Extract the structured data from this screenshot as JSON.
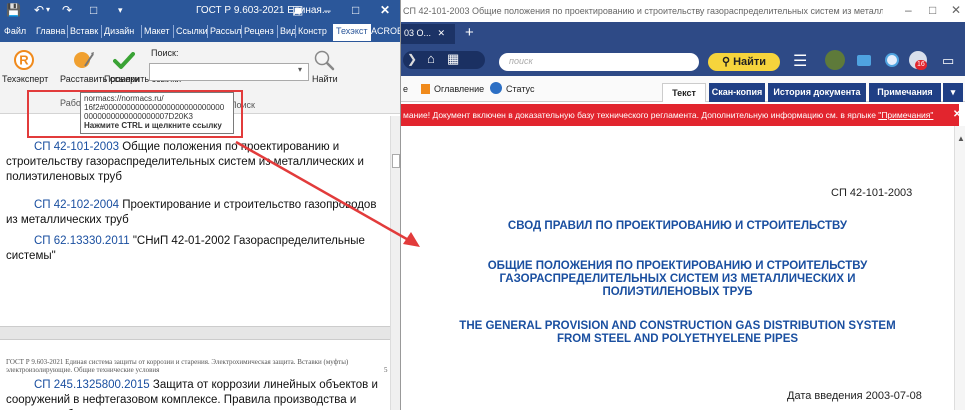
{
  "word": {
    "title": "ГОСТ Р 9.603-2021 Единая...",
    "tabs": [
      "Файл",
      "Главна",
      "Вставк",
      "Дизайн",
      "Макет",
      "Ссылки",
      "Рассыл",
      "Реценз",
      "Вид",
      "Констр",
      "Техэкст",
      "ACROB"
    ],
    "selected_tab": "Техэкст",
    "ribbon": {
      "btn_techexpert": "Техэксперт",
      "btn_arrange": "Расставить ссылки",
      "btn_check": "Проверить ссылки",
      "group_work": "Работ...",
      "search_label": "Поиск:",
      "search_value": "",
      "btn_find": "Найти",
      "group_search": "Поиск"
    },
    "tooltip": {
      "line1": "normacs://normacs.ru/",
      "line2": "16f2#000000000000000000000000000",
      "line3": "0000000000000000007D20K3",
      "hint": "Нажмите CTRL и щелкните ссылку"
    },
    "doc": [
      {
        "link": "СП 42-101-2003",
        "text": " Общие положения по проектированию и строительству газораспределительных систем из металлических и полиэтиленовых труб"
      },
      {
        "link": "СП 42-102-2004",
        "text": " Проектирование и строительство газопроводов из металлических труб"
      },
      {
        "link": "СП 62.13330.2011",
        "text": " \"СНиП 42-01-2002 Газораспределительные системы\""
      }
    ],
    "page_header": "ГОСТ Р 9.603-2021 Единая система защиты от коррозии и старения. Электрохимическая защита. Вставки (муфты) электроизолирующие. Общие технические условия",
    "page_number": "5",
    "doc2": {
      "link": "СП 245.1325800.2015",
      "text": " Защита от коррозии линейных объектов и сооружений в нефтегазовом комплексе. Правила производства и приемки работ"
    }
  },
  "browser": {
    "title": "СП 42-101-2003 Общие положения по проектированию и строительству газораспределительных систем из металлических и полиэтиленовых...",
    "tab_label": "03 О...",
    "search_placeholder": "поиск",
    "find_button": "Найти",
    "badge_count": "16",
    "nav_toc": "Оглавление",
    "nav_status": "Статус",
    "tabs": [
      "Текст",
      "Скан-копия",
      "История документа",
      "Примечания"
    ],
    "active_tab": "Текст",
    "alert_text": "мание! Документ включен в доказательную базу технического регламента. Дополнительную информацию см. в ярлыке ",
    "alert_link": "\"Примечания\"",
    "doc": {
      "code": "СП 42-101-2003",
      "heading1": "СВОД ПРАВИЛ ПО ПРОЕКТИРОВАНИЮ И СТРОИТЕЛЬСТВУ",
      "heading2_l1": "ОБЩИЕ ПОЛОЖЕНИЯ ПО ПРОЕКТИРОВАНИЮ И СТРОИТЕЛЬСТВУ",
      "heading2_l2": "ГАЗОРАСПРЕДЕЛИТЕЛЬНЫХ СИСТЕМ ИЗ МЕТАЛЛИЧЕСКИХ И",
      "heading2_l3": "ПОЛИЭТИЛЕНОВЫХ ТРУБ",
      "heading3_l1": "THE GENERAL PROVISION AND CONSTRUCTION GAS DISTRIBUTION SYSTEM",
      "heading3_l2": "FROM STEEL AND POLYETHYELENE PIPES",
      "date_intro": "Дата введения 2003-07-08"
    }
  },
  "colors": {
    "word_blue": "#2b579a",
    "browser_blue": "#2e4a86",
    "alert_red": "#e2252e",
    "link_blue": "#1a4fa0",
    "find_yellow": "#f6d43c",
    "annotation_red": "#e23b3b"
  }
}
